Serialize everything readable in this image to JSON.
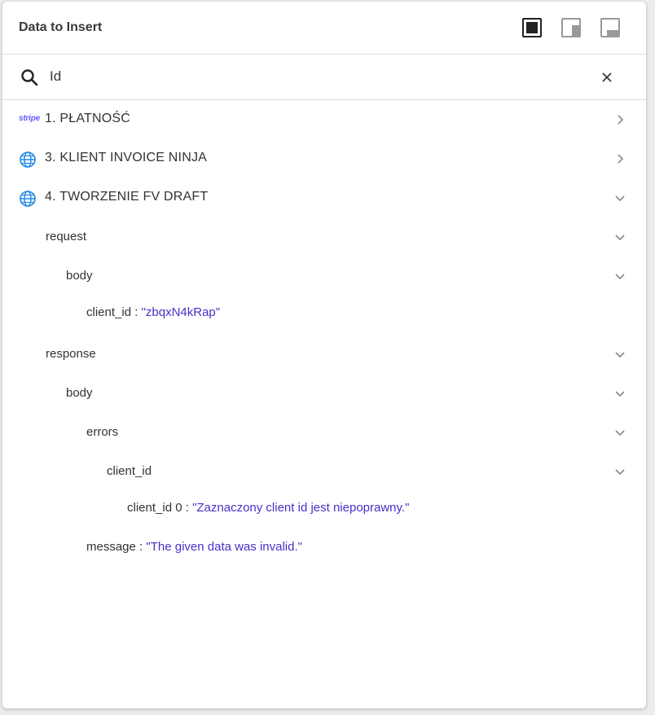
{
  "panel": {
    "title": "Data to Insert",
    "view_modes": [
      "full-view",
      "side-view",
      "bottom-view"
    ]
  },
  "search": {
    "value": "Id",
    "placeholder": ""
  },
  "tree": {
    "steps": [
      {
        "icon": "stripe-logo",
        "logo_text": "stripe",
        "label": "1. PŁATNOŚĆ",
        "expanded": false
      },
      {
        "icon": "globe-icon",
        "label": "3. KLIENT INVOICE NINJA",
        "expanded": false
      },
      {
        "icon": "globe-icon",
        "label": "4. TWORZENIE FV DRAFT",
        "expanded": true
      }
    ],
    "request": {
      "label": "request",
      "body": {
        "label": "body",
        "client_id": {
          "key": "client_id",
          "value": "\"zbqxN4kRap\""
        }
      }
    },
    "response": {
      "label": "response",
      "body": {
        "label": "body",
        "errors": {
          "label": "errors",
          "client_id": {
            "label": "client_id",
            "item0": {
              "key": "client_id 0",
              "value": "\"Zaznaczony client id jest niepoprawny.\""
            }
          }
        }
      },
      "message": {
        "key": "message",
        "value": "\"The given data was invalid.\""
      }
    },
    "separator": " : "
  },
  "colors": {
    "value_text": "#4b2fc9",
    "globe": "#1f88e5",
    "stripe": "#635bff"
  }
}
